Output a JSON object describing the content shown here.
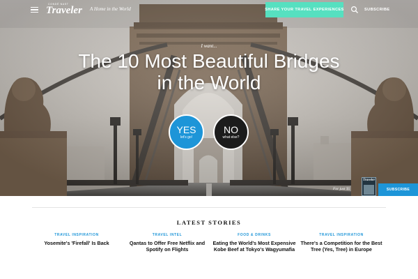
{
  "nav": {
    "brand_small": "CONDÉ NAST",
    "brand": "Traveler",
    "tagline": "A Home in the World",
    "share_label": "SHARE YOUR TRAVEL EXPERIENCES",
    "subscribe_label": "SUBSCRIBE"
  },
  "hero": {
    "kicker": "I want...",
    "headline": "The 10 Most Beautiful Bridges in the World",
    "yes_label": "YES",
    "yes_sub": "let's go!",
    "no_label": "NO",
    "no_sub": "what else?",
    "promo_text": "For just $5",
    "magazine_title": "Traveler",
    "subscribe_label": "SUBSCRIBE"
  },
  "latest": {
    "title": "LATEST STORIES",
    "stories": [
      {
        "category": "TRAVEL INSPIRATION",
        "title": "Yosemite's 'Firefall' Is Back"
      },
      {
        "category": "TRAVEL INTEL",
        "title": "Qantas to Offer Free Netflix and Spotify on Flights"
      },
      {
        "category": "FOOD & DRINKS",
        "title": "Eating the World's Most Expensive Kobe Beef at Tokyo's Wagyumafia"
      },
      {
        "category": "TRAVEL INSPIRATION",
        "title": "There's a Competition for the Best Tree (Yes, Tree) in Europe"
      }
    ]
  },
  "colors": {
    "accent_teal": "#56e0c0",
    "accent_blue": "#1d95d8",
    "no_button": "#1c1c1c"
  },
  "icons": {
    "menu": "hamburger-icon",
    "search": "search-icon"
  }
}
